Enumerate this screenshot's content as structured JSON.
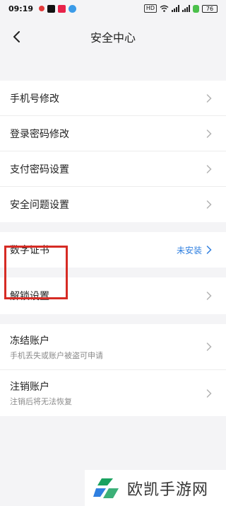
{
  "status_bar": {
    "time": "09:19",
    "hd_label": "HD",
    "battery": "76"
  },
  "header": {
    "title": "安全中心",
    "back_icon": "chevron-left-icon"
  },
  "groups": [
    {
      "items": [
        {
          "label": "手机号修改"
        },
        {
          "label": "登录密码修改"
        },
        {
          "label": "支付密码设置"
        },
        {
          "label": "安全问题设置"
        }
      ]
    },
    {
      "items": [
        {
          "label": "数字证书",
          "status": "未安装"
        }
      ]
    },
    {
      "items": [
        {
          "label": "解锁设置"
        }
      ]
    },
    {
      "items": [
        {
          "label": "冻结账户",
          "sub": "手机丢失或账户被盗可申请"
        },
        {
          "label": "注销账户",
          "sub": "注销后将无法恢复"
        }
      ]
    }
  ],
  "colors": {
    "accent_blue": "#2f7fe0",
    "highlight_red": "#d62b24",
    "background": "#f4f4f6"
  },
  "watermark": {
    "text": "欧凯手游网"
  }
}
